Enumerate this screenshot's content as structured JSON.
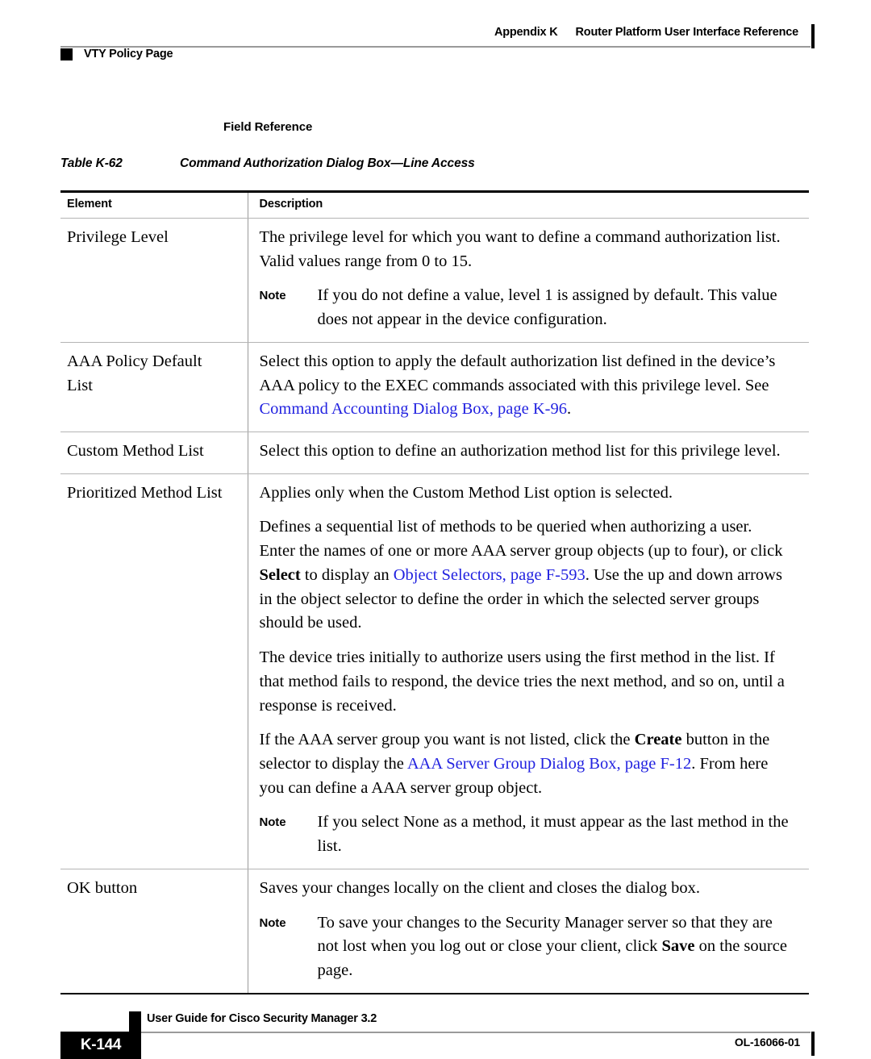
{
  "header": {
    "appendix_number": "Appendix K",
    "appendix_title": "Router Platform User Interface Reference",
    "running_section": "VTY Policy Page"
  },
  "section": {
    "heading": "Field Reference"
  },
  "table": {
    "caption_number": "Table K-62",
    "caption_title": "Command Authorization Dialog Box—Line Access",
    "columns": [
      "Element",
      "Description"
    ],
    "rows": [
      {
        "element": "Privilege Level",
        "paragraphs": [
          {
            "type": "text",
            "text": "The privilege level for which you want to define a command authorization list. Valid values range from 0 to 15."
          },
          {
            "type": "note",
            "label": "Note",
            "text": "If you do not define a value, level 1 is assigned by default. This value does not appear in the device configuration."
          }
        ]
      },
      {
        "element": "AAA Policy Default List",
        "element_lines": [
          "AAA Policy Default",
          "List"
        ],
        "paragraphs": [
          {
            "type": "rich",
            "parts": [
              {
                "style": "plain",
                "text": "Select this option to apply the default authorization list defined in the device’s AAA policy to the EXEC commands associated with this privilege level. See "
              },
              {
                "style": "link",
                "text": "Command Accounting Dialog Box, page K-96"
              },
              {
                "style": "plain",
                "text": "."
              }
            ]
          }
        ]
      },
      {
        "element": "Custom Method List",
        "element_lines": [
          "Custom Method List"
        ],
        "paragraphs": [
          {
            "type": "text",
            "text": "Select this option to define an authorization method list for this privilege level."
          }
        ]
      },
      {
        "element": "Prioritized Method List",
        "element_lines": [
          "Prioritized Method List"
        ],
        "paragraphs": [
          {
            "type": "text",
            "text": "Applies only when the Custom Method List option is selected."
          },
          {
            "type": "rich",
            "parts": [
              {
                "style": "plain",
                "text": "Defines a sequential list of methods to be queried when authorizing a user. Enter the names of one or more AAA server group objects (up to four), or click "
              },
              {
                "style": "bold",
                "text": "Select"
              },
              {
                "style": "plain",
                "text": " to display an "
              },
              {
                "style": "link",
                "text": "Object Selectors, page F-593"
              },
              {
                "style": "plain",
                "text": ". Use the up and down arrows in the object selector to define the order in which the selected server groups should be used."
              }
            ]
          },
          {
            "type": "text",
            "text": "The device tries initially to authorize users using the first method in the list. If that method fails to respond, the device tries the next method, and so on, until a response is received."
          },
          {
            "type": "rich",
            "parts": [
              {
                "style": "plain",
                "text": "If the AAA server group you want is not listed, click the "
              },
              {
                "style": "bold",
                "text": "Create"
              },
              {
                "style": "plain",
                "text": " button in the selector to display the "
              },
              {
                "style": "link",
                "text": "AAA Server Group Dialog Box, page F-12"
              },
              {
                "style": "plain",
                "text": ". From here you can define a AAA server group object."
              }
            ]
          },
          {
            "type": "note",
            "label": "Note",
            "text": "If you select None as a method, it must appear as the last method in the list."
          }
        ]
      },
      {
        "element": "OK button",
        "element_lines": [
          "OK button"
        ],
        "paragraphs": [
          {
            "type": "text",
            "text": "Saves your changes locally on the client and closes the dialog box."
          },
          {
            "type": "note-rich",
            "label": "Note",
            "parts": [
              {
                "style": "plain",
                "text": "To save your changes to the Security Manager server so that they are not lost when you log out or close your client, click "
              },
              {
                "style": "bold",
                "text": "Save"
              },
              {
                "style": "plain",
                "text": " on the source page."
              }
            ]
          }
        ]
      }
    ]
  },
  "footer": {
    "page_number": "K-144",
    "guide_title": "User Guide for Cisco Security Manager 3.2",
    "document_id": "OL-16066-01"
  },
  "colors": {
    "link": "#2222e0",
    "rule": "#9a9a9a",
    "page_box": "#000000"
  }
}
